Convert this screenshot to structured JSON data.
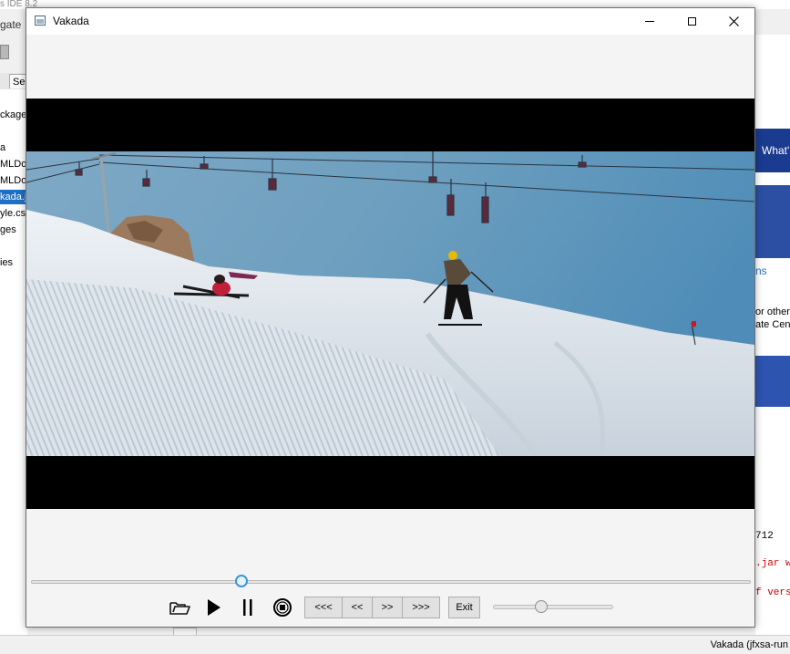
{
  "ide": {
    "title_fragment": "s IDE 8.2",
    "toolbar_fragment": "gate",
    "tab_label": "Se",
    "tree_items": [
      {
        "label": "ckages",
        "selected": false
      },
      {
        "label": "a",
        "selected": false
      },
      {
        "label": "MLDoc",
        "selected": false
      },
      {
        "label": "MLDoc",
        "selected": false
      },
      {
        "label": "kada.j",
        "selected": true
      },
      {
        "label": "yle.css",
        "selected": false
      },
      {
        "label": "ges",
        "selected": false
      },
      {
        "label": "ies",
        "selected": false
      }
    ],
    "right_panel": {
      "banner_text": "What'",
      "link_text": "ns",
      "text_line1": "or other",
      "text_line2": "ate Cen",
      "console_line1": "712",
      "console_line2": ".jar w",
      "console_line3": "f vers"
    },
    "status_text": "Vakada (jfxsa-run"
  },
  "window": {
    "title": "Vakada",
    "controls": {
      "minimize_icon": "minimize-icon",
      "maximize_icon": "maximize-icon",
      "close_icon": "close-icon"
    }
  },
  "player": {
    "seek_progress": 0.29,
    "volume_level": 0.4,
    "open_icon": "folder-open-icon",
    "play_icon": "play-icon",
    "pause_icon": "pause-icon",
    "stop_icon": "stop-icon",
    "buttons": {
      "seek_back_far": "<<<",
      "seek_back": "<<",
      "seek_forward": ">>",
      "seek_forward_far": ">>>",
      "exit": "Exit"
    }
  },
  "colors": {
    "accent": "#3a96dd",
    "selection": "#1f6fc5",
    "ide_banner": "#1a3b8f"
  }
}
